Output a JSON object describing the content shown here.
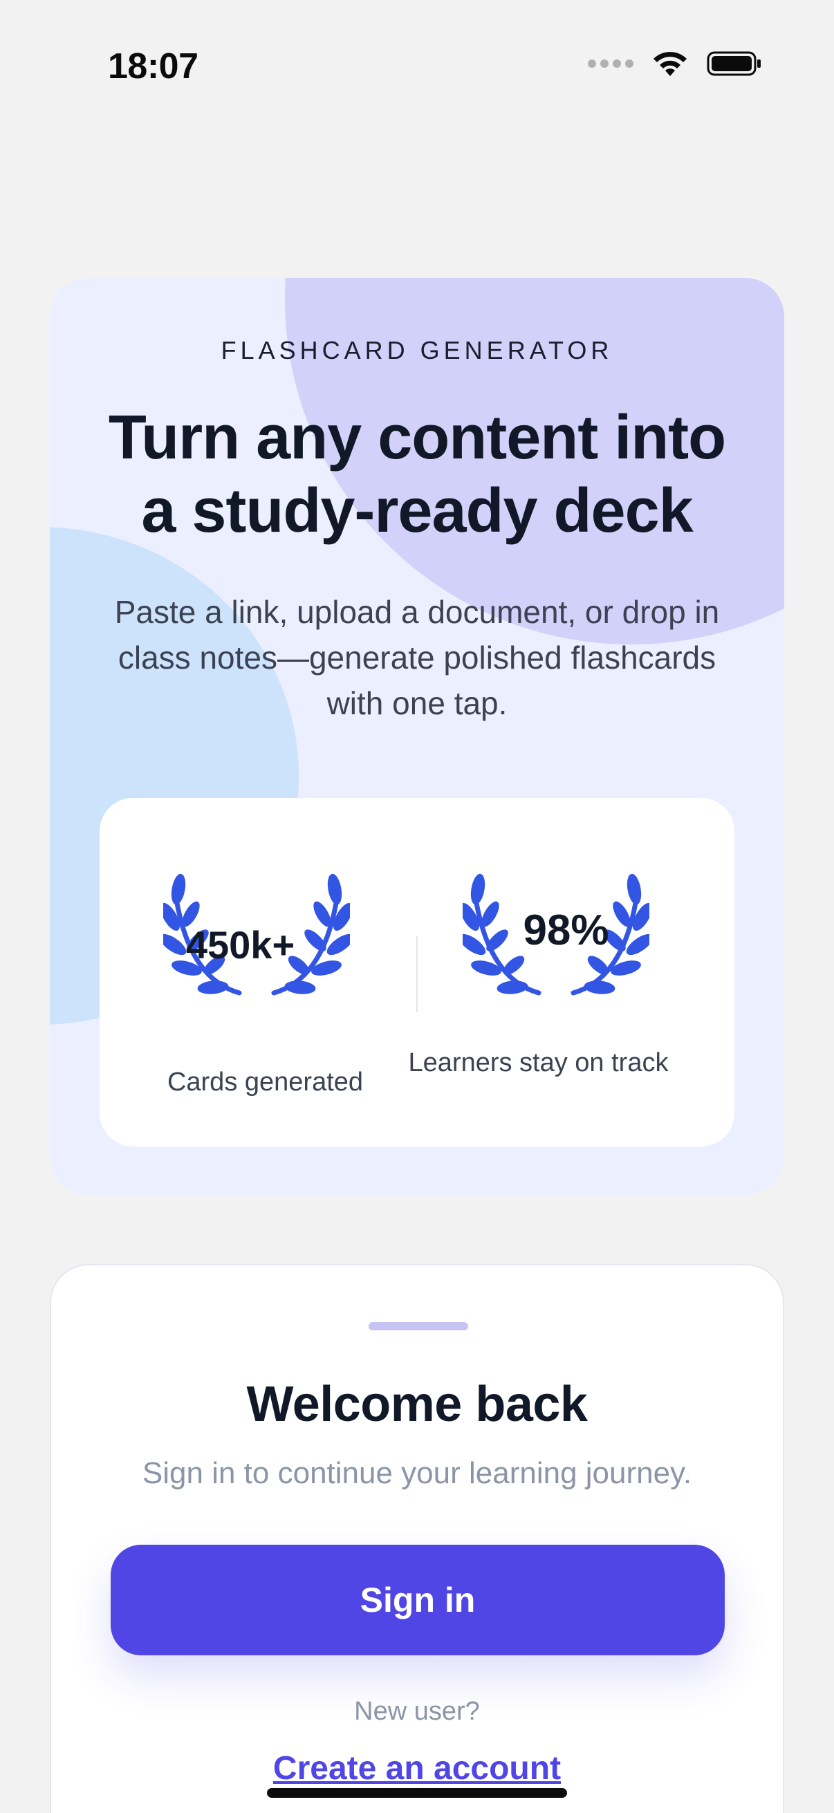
{
  "status_bar": {
    "time": "18:07"
  },
  "hero": {
    "eyebrow": "FLASHCARD GENERATOR",
    "headline_line1": "Turn any content into",
    "headline_line2": "a study-ready deck",
    "subhead": "Paste a link, upload a document, or drop in class notes—generate polished flashcards with one tap."
  },
  "stats": [
    {
      "value": "450k+",
      "label": "Cards generated"
    },
    {
      "value": "98%",
      "label": "Learners stay on track"
    }
  ],
  "sheet": {
    "title": "Welcome back",
    "subtitle": "Sign in to continue your learning journey.",
    "signin_label": "Sign in",
    "new_user_label": "New user?",
    "create_account_label": "Create an account"
  },
  "colors": {
    "accent": "#4f46e5",
    "laurel": "#3256e3",
    "hero_bg": "#ecefff"
  },
  "icons": [
    "wifi-icon",
    "battery-icon",
    "signal-icon",
    "laurel-icon"
  ]
}
